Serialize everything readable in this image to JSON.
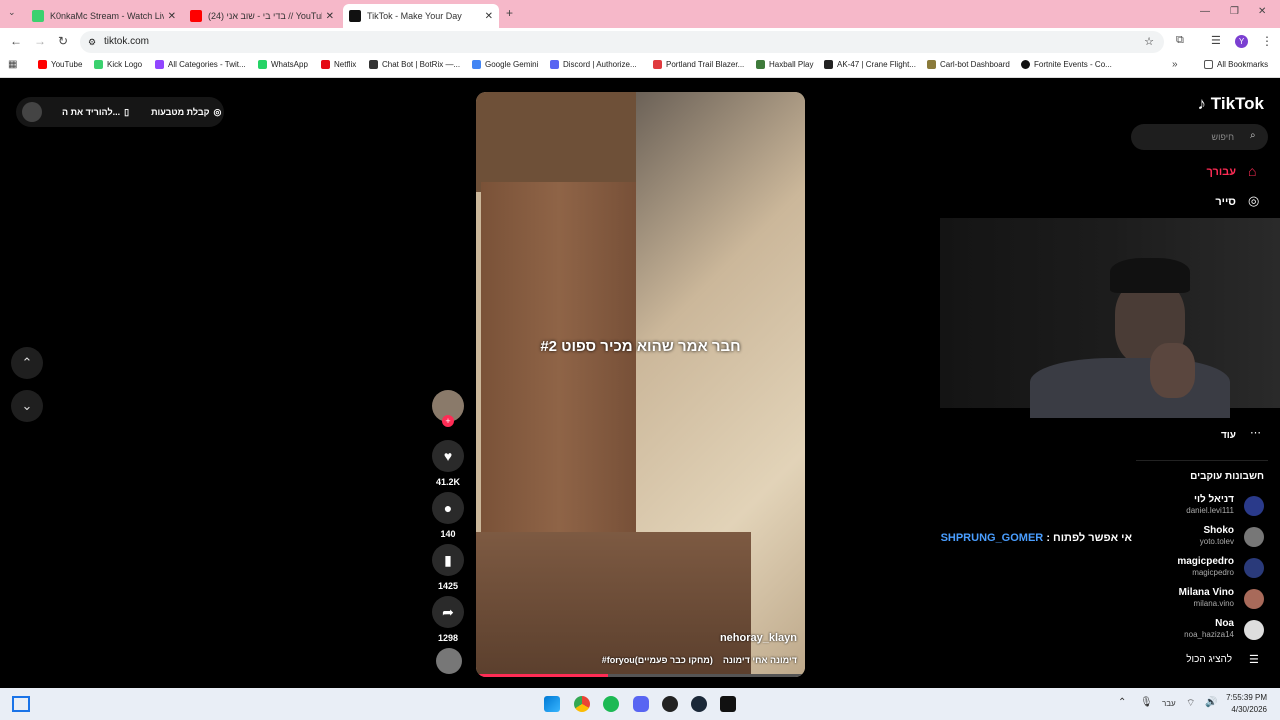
{
  "tabs": [
    {
      "title": "K0nkaMc Stream - Watch Live o",
      "fav": "#3bd16f"
    },
    {
      "title": "(24) בדי בי - שוב אני // YouTube",
      "fav": "#ff0000"
    },
    {
      "title": "TikTok - Make Your Day",
      "fav": "#111"
    }
  ],
  "address": {
    "url": "tiktok.com"
  },
  "bookmarks": [
    "YouTube",
    "Kick Logo",
    "All Categories - Twit...",
    "WhatsApp",
    "Netflix",
    "Chat Bot | BotRix —...",
    "Google Gemini",
    "Discord | Authorize...",
    "Portland Trail Blazer...",
    "Haxball Play",
    "AK-47 | Crane Flight...",
    "Carl-bot Dashboard",
    "Fortnite Events - Co...",
    "All Bookmarks"
  ],
  "pill": {
    "coins": "קבלת מטבעות",
    "download": "להוריד את ה..."
  },
  "sidebar": {
    "logo": "TikTok",
    "search": "חיפוש",
    "foryou": "עבורך",
    "explore": "סייר",
    "more": "עוד",
    "following_title": "חשבונות עוקבים",
    "show_all": "להציג הכול"
  },
  "following": [
    {
      "name": "דניאל לוי",
      "user": "daniel.levi111"
    },
    {
      "name": "Shoko",
      "user": "yoto.tolev"
    },
    {
      "name": "magicpedro",
      "user": "magicpedro"
    },
    {
      "name": "Milana Vino",
      "user": "milana.vino"
    },
    {
      "name": "Noa",
      "user": "noa_haziza14"
    }
  ],
  "overlay_comment": {
    "user": "SHPRUNG_GOMER",
    "text": "אי אפשר לפתוח :"
  },
  "video": {
    "caption": "חבר אמר שהוא מכיר ספוט #2",
    "author": "nehoray_klayn",
    "desc": "דימונה אחי דימונה",
    "tags": "(מחקו כבר פעמיים)foryou#",
    "progress": 0.4
  },
  "stats": {
    "likes": "41.2K",
    "comments": "140",
    "saves": "1425",
    "shares": "1298"
  },
  "taskbar": {
    "time": "7:55:39 PM",
    "date": "4/30/2026",
    "lang": "עבר"
  }
}
